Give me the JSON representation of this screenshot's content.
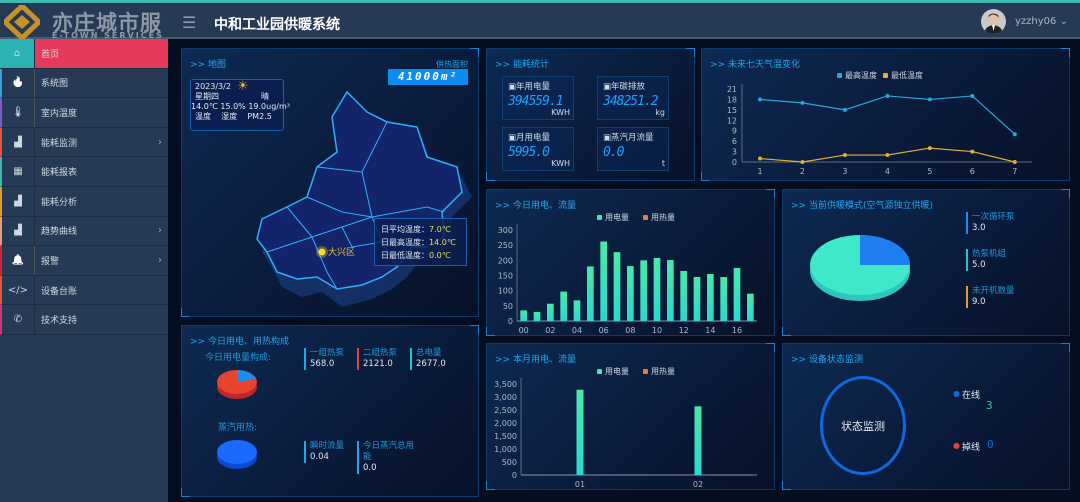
{
  "header": {
    "logo_cn": "亦庄城市服务",
    "logo_en": "E-TOWN SERVICES",
    "title": "中和工业园供暖系统",
    "user": "yzzhy06"
  },
  "sidebar": {
    "items": [
      {
        "label": "首页",
        "icon": "home-icon",
        "active": true,
        "arrow": false,
        "accent": "#3fb8b0"
      },
      {
        "label": "系统图",
        "icon": "flame-icon",
        "arrow": false,
        "accent": "#2ea4d8"
      },
      {
        "label": "室内温度",
        "icon": "thermometer-icon",
        "arrow": false,
        "accent": "#7b5cc4"
      },
      {
        "label": "能耗监测",
        "icon": "area-chart-icon",
        "arrow": true,
        "accent": "#e0543a"
      },
      {
        "label": "能耗报表",
        "icon": "calendar-icon",
        "arrow": false,
        "accent": "#3fb8b0"
      },
      {
        "label": "能耗分析",
        "icon": "area-chart-icon",
        "arrow": false,
        "accent": "#e39a2a"
      },
      {
        "label": "趋势曲线",
        "icon": "area-chart-icon",
        "arrow": true,
        "accent": "#e0a080"
      },
      {
        "label": "报警",
        "icon": "bell-icon",
        "arrow": true,
        "accent": "#c8283c"
      },
      {
        "label": "设备台账",
        "icon": "code-icon",
        "arrow": false,
        "accent": "#e0543a"
      },
      {
        "label": "技术支持",
        "icon": "phone-icon",
        "arrow": false,
        "accent": "#c83a7a"
      }
    ]
  },
  "map": {
    "title": ">> 地图",
    "area_label": "供热面积",
    "area_value": "41000m²",
    "weather": {
      "date": "2023/3/2",
      "weekday": "星期四",
      "condition": "晴",
      "temp": "14.0℃",
      "humidity": "15.0%",
      "pm25": "19.0ug/m³",
      "temp_label": "温度",
      "humidity_label": "湿度",
      "pm_label": "PM2.5"
    },
    "district": "大兴区",
    "temps": [
      {
        "label": "日平均温度：",
        "value": "7.0℃"
      },
      {
        "label": "日最高温度：",
        "value": "14.0℃"
      },
      {
        "label": "日最低温度：",
        "value": "0.0℃"
      }
    ]
  },
  "energy": {
    "title": ">> 能耗统计",
    "stats": [
      {
        "label": "年用电量",
        "value": "394559.1",
        "unit": "KWH"
      },
      {
        "label": "年碳排放",
        "value": "348251.2",
        "unit": "kg"
      },
      {
        "label": "月用电量",
        "value": "5995.0",
        "unit": "KWH"
      },
      {
        "label": "蒸汽月流量",
        "value": "0.0",
        "unit": "t"
      }
    ]
  },
  "composition": {
    "title": ">> 今日用电、用热构成",
    "elec_label": "今日用电量构成:",
    "steam_label": "蒸汽用热:",
    "elec_items": [
      {
        "label": "一组热泵",
        "value": "568.0",
        "color": "#1fa8f0"
      },
      {
        "label": "二组热泵",
        "value": "2121.0",
        "color": "#e0433a"
      },
      {
        "label": "总电量",
        "value": "2677.0",
        "color": "#1fc8d0"
      }
    ],
    "steam_items": [
      {
        "label": "瞬时流量",
        "value": "0.04"
      },
      {
        "label": "今日蒸汽总用能",
        "value": "0.0"
      }
    ]
  },
  "supply": {
    "title": ">> 当前供暖模式(空气源独立供暖)",
    "items": [
      {
        "label": "一次循环泵",
        "value": "3.0",
        "color": "#1f8df0"
      },
      {
        "label": "热泵机组",
        "value": "5.0",
        "color": "#1fc8c0"
      },
      {
        "label": "未开机数量",
        "value": "9.0",
        "color": "#e0a020"
      }
    ]
  },
  "device": {
    "title": ">> 设备状态监测",
    "center": "状态监测",
    "online_label": "在线",
    "online": "3",
    "offline_label": "掉线",
    "offline": "0"
  },
  "chart_data": [
    {
      "id": "weather",
      "type": "line",
      "title": ">> 未来七天气温变化",
      "x": [
        1,
        2,
        3,
        4,
        5,
        6,
        7
      ],
      "ylim": [
        0,
        21
      ],
      "yticks": [
        0,
        3,
        6,
        9,
        12,
        15,
        18,
        21
      ],
      "series": [
        {
          "name": "最高温度",
          "color": "#29a8e0",
          "values": [
            18,
            17,
            15,
            19,
            18,
            19,
            8
          ]
        },
        {
          "name": "最低温度",
          "color": "#e0b030",
          "values": [
            1,
            0,
            2,
            2,
            4,
            3,
            0
          ]
        }
      ]
    },
    {
      "id": "daily",
      "type": "bar",
      "title": ">> 今日用电、流量",
      "categories": [
        "00",
        "01",
        "02",
        "03",
        "04",
        "05",
        "06",
        "07",
        "08",
        "09",
        "10",
        "11",
        "12",
        "13",
        "14",
        "15",
        "16",
        "17"
      ],
      "xticks": [
        "00",
        "02",
        "04",
        "06",
        "08",
        "10",
        "12",
        "14",
        "16"
      ],
      "ylim": [
        0,
        300
      ],
      "yticks": [
        0,
        50,
        100,
        150,
        200,
        250,
        300
      ],
      "series": [
        {
          "name": "用电量",
          "color": "#3fe8b0",
          "values": [
            35,
            30,
            57,
            97,
            68,
            180,
            262,
            227,
            181,
            200,
            208,
            201,
            165,
            145,
            155,
            145,
            175,
            90
          ]
        },
        {
          "name": "用热量",
          "color": "#e8803a",
          "values": []
        }
      ]
    },
    {
      "id": "monthly",
      "type": "bar",
      "title": ">> 本月用电、流量",
      "categories": [
        "01",
        "02"
      ],
      "ylim": [
        0,
        3500
      ],
      "yticks": [
        "0",
        "500",
        "1,000",
        "1,500",
        "2,000",
        "2,500",
        "3,000",
        "3,500"
      ],
      "series": [
        {
          "name": "用电量",
          "color": "#3fe8b0",
          "values": [
            3280,
            2640
          ]
        },
        {
          "name": "用热量",
          "color": "#e8803a",
          "values": []
        }
      ]
    },
    {
      "id": "supply-pie",
      "type": "pie",
      "labels": [
        "一次循环泵",
        "热泵机组+未开机"
      ],
      "values": [
        25,
        75
      ],
      "colors": [
        "#1f7ff0",
        "#3fe8c8"
      ]
    }
  ]
}
